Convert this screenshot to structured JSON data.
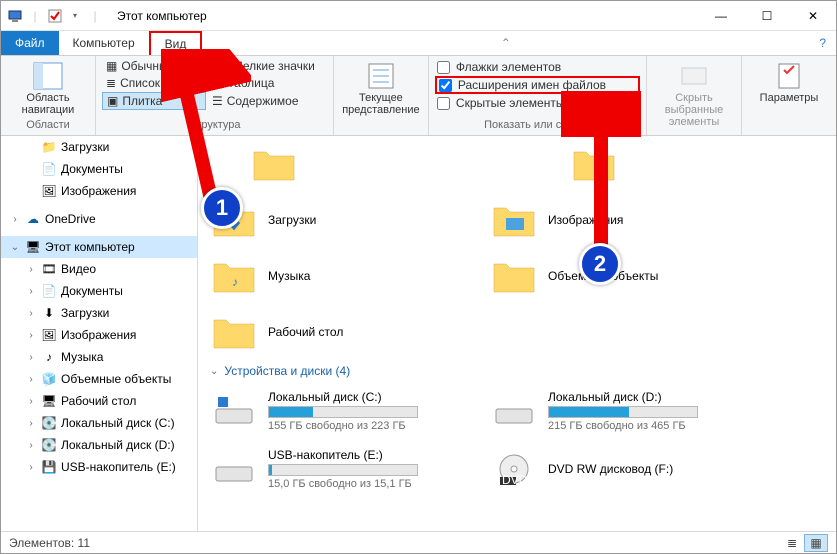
{
  "window": {
    "title": "Этот компьютер"
  },
  "tabs": {
    "file": "Файл",
    "computer": "Компьютер",
    "view": "Вид"
  },
  "ribbon": {
    "panes": {
      "label": "Область навигации",
      "group": "Области"
    },
    "layout": {
      "regular": "Обычные значки",
      "small": "Мелкие значки",
      "list": "Список",
      "table": "Таблица",
      "tiles": "Плитка",
      "content": "Содержимое",
      "group": "Структура"
    },
    "current": {
      "label": "Текущее представление"
    },
    "checks": {
      "flags": "Флажки элементов",
      "extensions": "Расширения имен файлов",
      "hidden": "Скрытые элементы",
      "group": "Показать или скрыть"
    },
    "hide": {
      "label": "Скрыть выбранные элементы"
    },
    "params": {
      "label": "Параметры"
    }
  },
  "nav": {
    "downloads": "Загрузки",
    "documents": "Документы",
    "pictures": "Изображения",
    "onedrive": "OneDrive",
    "thispc": "Этот компьютер",
    "videos": "Видео",
    "documents2": "Документы",
    "downloads2": "Загрузки",
    "pictures2": "Изображения",
    "music": "Музыка",
    "objects3d": "Объемные объекты",
    "desktop": "Рабочий стол",
    "diskc": "Локальный диск (C:)",
    "diskd": "Локальный диск (D:)",
    "diske": "USB-накопитель (E:)"
  },
  "folders": {
    "downloads": "Загрузки",
    "pictures": "Изображения",
    "music": "Музыка",
    "objects3d": "Объемные объекты",
    "desktop": "Рабочий стол"
  },
  "section_drives": "Устройства и диски (4)",
  "drives": {
    "c": {
      "name": "Локальный диск (C:)",
      "sub": "155 ГБ свободно из 223 ГБ",
      "fill": 30
    },
    "d": {
      "name": "Локальный диск (D:)",
      "sub": "215 ГБ свободно из 465 ГБ",
      "fill": 54
    },
    "e": {
      "name": "USB-накопитель (E:)",
      "sub": "15,0 ГБ свободно из 15,1 ГБ",
      "fill": 2
    },
    "f": {
      "name": "DVD RW дисковод (F:)"
    }
  },
  "status": {
    "elements": "Элементов: 11"
  },
  "callouts": {
    "one": "1",
    "two": "2"
  }
}
